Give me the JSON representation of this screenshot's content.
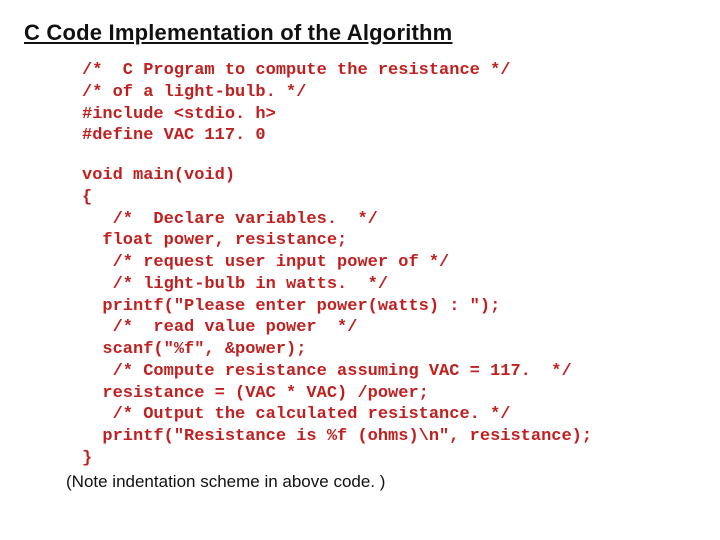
{
  "title": "C Code Implementation of the Algorithm",
  "code_block_1": [
    "/*  C Program to compute the resistance */",
    "/* of a light-bulb. */",
    "#include <stdio. h>",
    "#define VAC 117. 0"
  ],
  "code_block_2": [
    "void main(void)",
    "{",
    "   /*  Declare variables.  */",
    "  float power, resistance;",
    "   /* request user input power of */",
    "   /* light-bulb in watts.  */",
    "  printf(\"Please enter power(watts) : \");",
    "   /*  read value power  */",
    "  scanf(\"%f\", &power);",
    "   /* Compute resistance assuming VAC = 117.  */",
    "  resistance = (VAC * VAC) /power;",
    "   /* Output the calculated resistance. */",
    "  printf(\"Resistance is %f (ohms)\\n\", resistance);",
    "}"
  ],
  "note": "(Note indentation scheme in above code. )"
}
